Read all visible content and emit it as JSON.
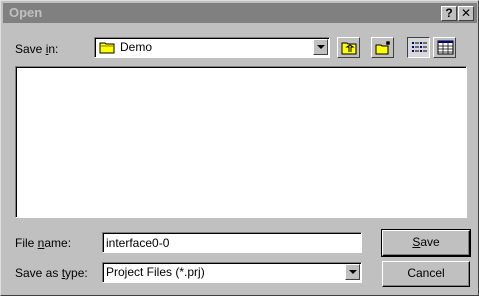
{
  "window": {
    "title": "Open",
    "help_glyph": "?",
    "close_glyph": "✕"
  },
  "save_in": {
    "label_pre": "Save ",
    "label_ul": "i",
    "label_post": "n:",
    "folder": "Demo"
  },
  "file_name": {
    "label_pre": "File ",
    "label_ul": "n",
    "label_post": "ame:",
    "value": "interface0-0"
  },
  "save_as_type": {
    "label_pre": "Save as ",
    "label_ul": "t",
    "label_post": "ype:",
    "value": "Project Files (*.prj)"
  },
  "buttons": {
    "save_ul": "S",
    "save_rest": "ave",
    "cancel": "Cancel"
  },
  "toolbar": {
    "icons": [
      "up-one-level-icon",
      "create-new-folder-icon",
      "list-view-icon",
      "details-view-icon"
    ],
    "pressed": "list-view-icon"
  },
  "colors": {
    "face": "#c0c0c0",
    "titlebar_inactive": "#808080",
    "folder_yellow": "#ffff00"
  }
}
